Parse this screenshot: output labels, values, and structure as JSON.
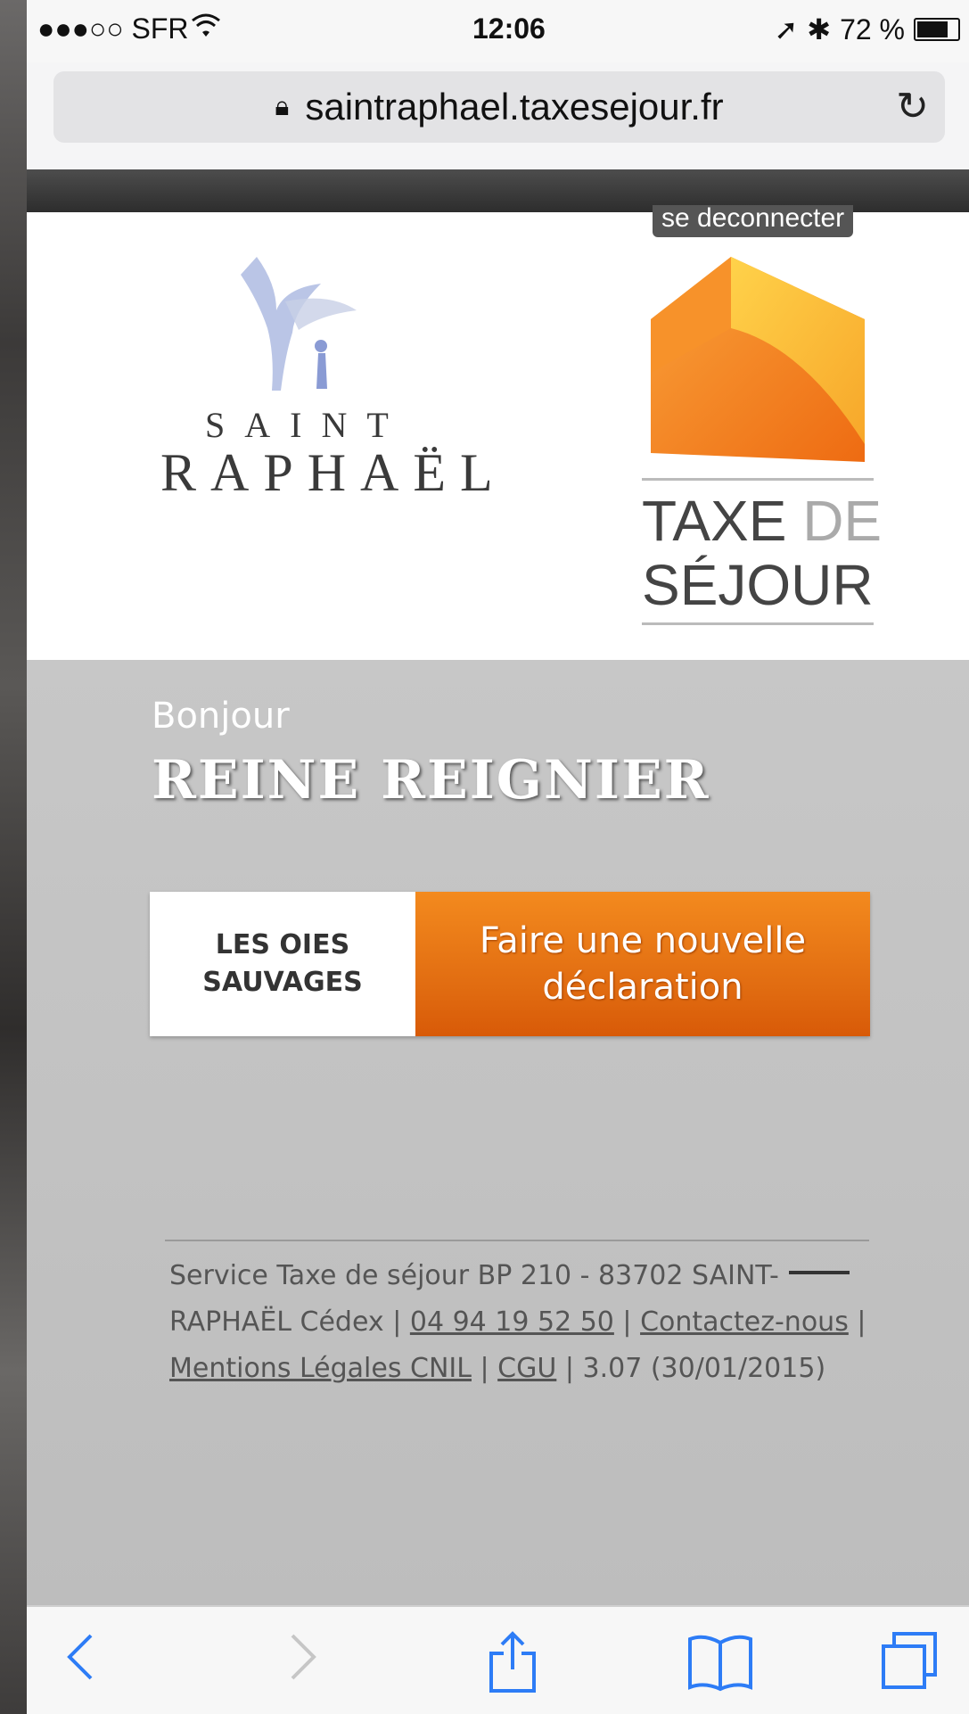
{
  "status_bar": {
    "carrier": "●●●○○ SFR",
    "time": "12:06",
    "battery": "72 %"
  },
  "browser": {
    "url": "saintraphael.taxesejour.fr"
  },
  "header": {
    "logout_label": "se deconnecter"
  },
  "logos": {
    "city_top": "SAINT",
    "city_bottom": "RAPHAËL",
    "tax_line1_a": "TAXE",
    "tax_line1_b": "DE",
    "tax_line2": "SÉJOUR"
  },
  "greeting": {
    "hello": "Bonjour",
    "name": "REINE REIGNIER"
  },
  "property_card": {
    "property_name": "LES OIES\nSAUVAGES",
    "action_label": "Faire une nouvelle\ndéclaration"
  },
  "footer": {
    "address": "Service Taxe de séjour BP 210 - 83702 SAINT-RAPHAËL Cédex |",
    "phone": "04 94 19 52 50",
    "contact": "Contactez-nous",
    "legal": "Mentions Légales CNIL",
    "cgu": "CGU",
    "version": "3.07 (30/01/2015)"
  },
  "colors": {
    "accent_orange": "#f38a1e",
    "ios_blue": "#2d7cf6"
  }
}
